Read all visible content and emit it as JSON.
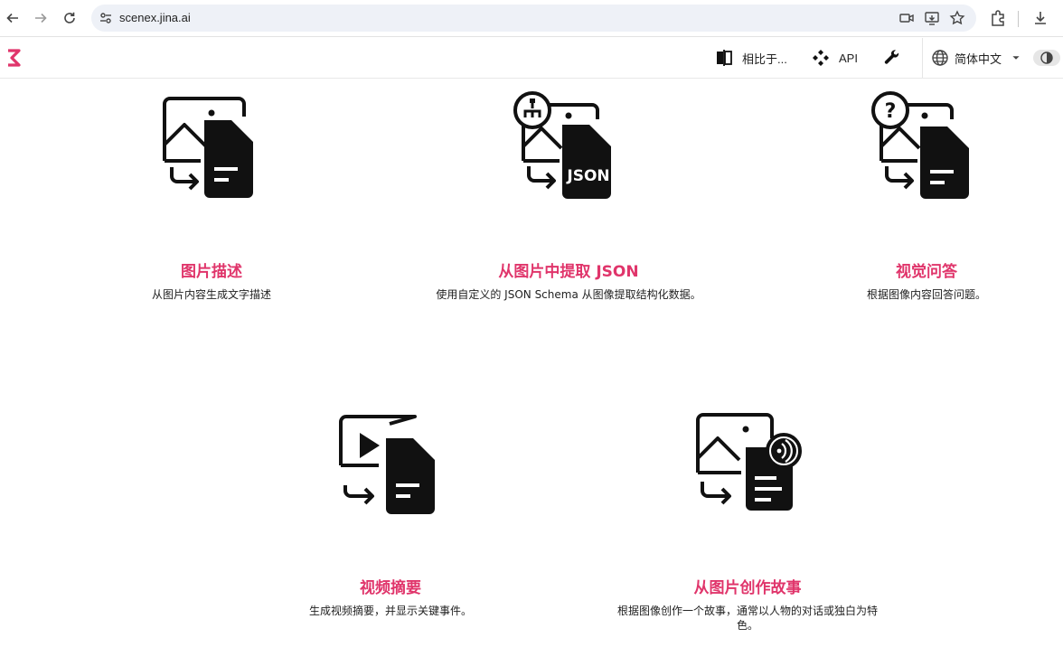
{
  "browser": {
    "url": "scenex.jina.ai"
  },
  "header": {
    "compare_label": "相比于...",
    "api_label": "API",
    "language_label": "简体中文"
  },
  "features": [
    {
      "title": "图片描述",
      "description": "从图片内容生成文字描述"
    },
    {
      "title": "从图片中提取 JSON",
      "description": "使用自定义的 JSON Schema 从图像提取结构化数据。",
      "badge": "JSON"
    },
    {
      "title": "视觉问答",
      "description": "根据图像内容回答问题。"
    },
    {
      "title": "视频摘要",
      "description": "生成视频摘要，并显示关键事件。"
    },
    {
      "title": "从图片创作故事",
      "description": "根据图像创作一个故事，通常以人物的对话或独白为特色。"
    }
  ],
  "colors": {
    "accent": "#e0356b",
    "icon": "#111111"
  }
}
